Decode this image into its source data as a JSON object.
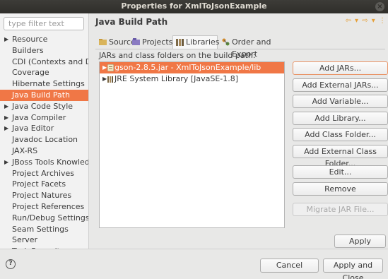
{
  "window": {
    "title": "Properties for XmlToJsonExample",
    "close_glyph": "×"
  },
  "filter": {
    "placeholder": "type filter text"
  },
  "tree": [
    {
      "label": "Resource",
      "expandable": true
    },
    {
      "label": "Builders",
      "expandable": false
    },
    {
      "label": "CDI (Contexts and Dep",
      "expandable": false
    },
    {
      "label": "Coverage",
      "expandable": false
    },
    {
      "label": "Hibernate Settings",
      "expandable": false
    },
    {
      "label": "Java Build Path",
      "expandable": false,
      "selected": true
    },
    {
      "label": "Java Code Style",
      "expandable": true
    },
    {
      "label": "Java Compiler",
      "expandable": true
    },
    {
      "label": "Java Editor",
      "expandable": true
    },
    {
      "label": "Javadoc Location",
      "expandable": false
    },
    {
      "label": "JAX-RS",
      "expandable": false
    },
    {
      "label": "JBoss Tools Knowledg",
      "expandable": true
    },
    {
      "label": "Project Archives",
      "expandable": false
    },
    {
      "label": "Project Facets",
      "expandable": false
    },
    {
      "label": "Project Natures",
      "expandable": false
    },
    {
      "label": "Project References",
      "expandable": false
    },
    {
      "label": "Run/Debug Settings",
      "expandable": false
    },
    {
      "label": "Seam Settings",
      "expandable": false
    },
    {
      "label": "Server",
      "expandable": false
    },
    {
      "label": "Task Repository",
      "expandable": true
    }
  ],
  "page": {
    "heading": "Java Build Path",
    "nav_arrows": "⇦ ▾ ⇨ ▾ ⋮"
  },
  "tabs": [
    {
      "label": "Source",
      "icon": "source-folder-icon"
    },
    {
      "label": "Projects",
      "icon": "projects-icon"
    },
    {
      "label": "Libraries",
      "icon": "libraries-icon",
      "active": true
    },
    {
      "label": "Order and Export",
      "icon": "order-export-icon"
    }
  ],
  "libraries": {
    "caption": "JARs and class folders on the build path:",
    "entries": [
      {
        "label": "gson-2.8.5.jar - XmlToJsonExample/lib",
        "icon": "jar-icon",
        "selected": true
      },
      {
        "label": "JRE System Library [JavaSE-1.8]",
        "icon": "library-icon",
        "selected": false
      }
    ]
  },
  "buttons": {
    "add_jars": "Add JARs...",
    "add_external_jars": "Add External JARs...",
    "add_variable": "Add Variable...",
    "add_library": "Add Library...",
    "add_class_folder": "Add Class Folder...",
    "add_external_class_folder": "Add External Class Folder...",
    "edit": "Edit...",
    "remove": "Remove",
    "migrate_jar": "Migrate JAR File...",
    "apply": "Apply",
    "cancel": "Cancel",
    "apply_and_close": "Apply and Close",
    "help_glyph": "?"
  },
  "colors": {
    "selection": "#f07746",
    "titlebar": "#2f2e2a",
    "accent_arrows": "#e6a13a"
  }
}
